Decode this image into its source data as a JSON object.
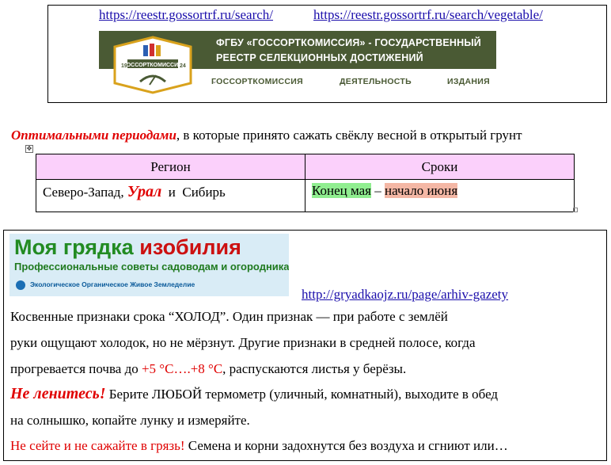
{
  "header": {
    "links": [
      "https://reestr.gossortrf.ru/search/",
      "https://reestr.gossortrf.ru/search/vegetable/"
    ],
    "banner": {
      "title_line1": "ФГБУ «ГОССОРТКОМИССИЯ» - ГОСУДАРСТВЕННЫЙ",
      "title_line2": "РЕЕСТР СЕЛЕКЦИОННЫХ ДОСТИЖЕНИЙ",
      "emblem_year_left": "19",
      "emblem_year_right": "24",
      "emblem_text": "ГОССОРТКОМИССИЯ",
      "nav": [
        {
          "label": "ГОССОРТКОМИССИЯ",
          "caret": "⌄"
        },
        {
          "label": "ДЕЯТЕЛЬНОСТЬ",
          "caret": "⌄"
        },
        {
          "label": "ИЗДАНИЯ",
          "caret": ""
        }
      ],
      "colors": {
        "band": "#4a5a34",
        "accent": "#d9a21c",
        "nav_text": "#4a5a34"
      }
    }
  },
  "intro": {
    "emphasis": "Оптимальными периодами",
    "rest": ", в которые принято сажать свёклу весной в открытый грунт"
  },
  "table": {
    "headers": [
      "Регион",
      "Сроки"
    ],
    "region": {
      "part1": "Северо-Запад,",
      "ural": "Урал",
      "conj": "и",
      "part2": "Сибирь"
    },
    "dates": {
      "start": "Конец мая",
      "dash": "–",
      "end": "начало июня"
    }
  },
  "article": {
    "logo": {
      "word1": "Моя грядка",
      "word2": "изобилия",
      "subtitle": "Профессиональные советы садоводам и огородникам",
      "footer": "Экологическое Органическое Живое Земледелие"
    },
    "link": "http://gryadkaojz.ru/page/arhiv-gazety",
    "line1": "Косвенные признаки срока “ХОЛОД”. Один признак — при работе с землёй",
    "line2": "руки ощущают холодок, но не мёрзнут. Другие признаки в средней полосе, когда",
    "line3_a": "прогревается почва до ",
    "line3_temp": "+5 °С….+8 °С",
    "line3_b": ", распускаются листья у берёзы.",
    "line4_red": "Не ленитесь!",
    "line4_b": " Берите ЛЮБОЙ термометр (уличный, комнатный), выходите в обед",
    "line5": "на солнышко, копайте лунку и измеряйте.",
    "line6_red": "Не сейте и не сажайте в грязь!",
    "line6_b": " Семена и корни задохнутся без воздуха и сгниют или…"
  }
}
